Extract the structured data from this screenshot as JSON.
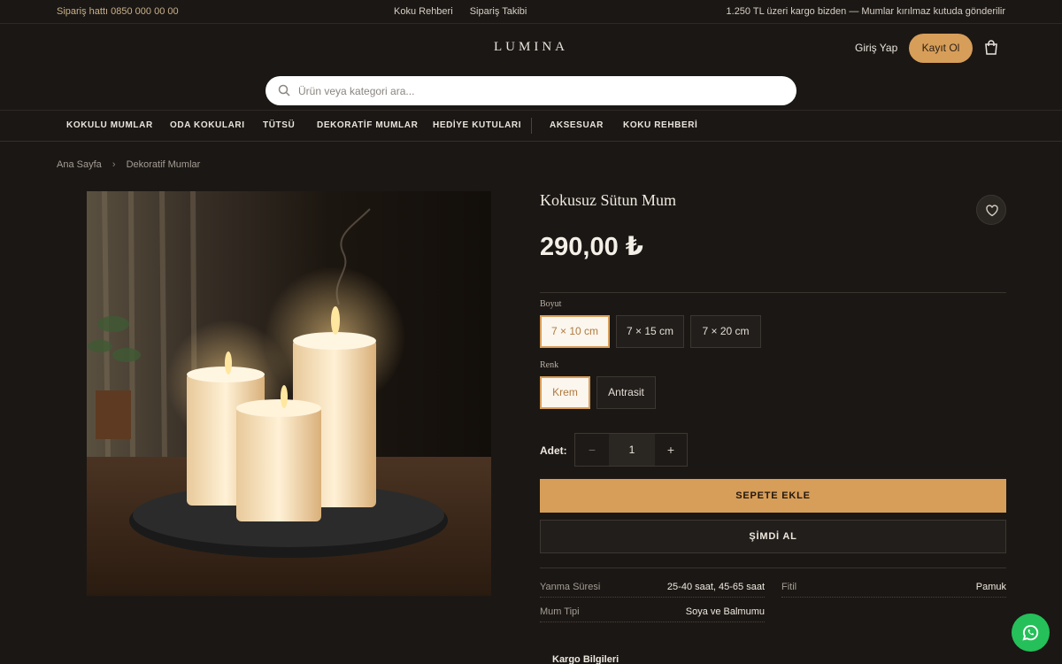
{
  "topbar": {
    "hotline": "Sipariş hattı 0850 000 00 00",
    "links": [
      "Koku Rehberi",
      "Sipariş Takibi"
    ],
    "shipping_note": "1.250 TL üzeri kargo bizden — Mumlar kırılmaz kutuda gönderilir"
  },
  "header": {
    "logo": "LUMINA",
    "login_label": "Giriş Yap",
    "register_label": "Kayıt Ol",
    "cart_icon": "shopping-bag-icon"
  },
  "search": {
    "placeholder": "Ürün veya kategori ara...",
    "value": ""
  },
  "nav": {
    "items": [
      "KOKULU MUMLAR",
      "ODA KOKULARI",
      "TÜTSÜ",
      "DEKORATİF MUMLAR",
      "HEDİYE KUTULARI",
      "AKSESUAR",
      "KOKU REHBERİ"
    ]
  },
  "breadcrumb": {
    "home": "Ana Sayfa",
    "separator": "›",
    "current": "Dekoratif Mumlar"
  },
  "product": {
    "title": "Kokusuz Sütun Mum",
    "price": "290,00 ₺",
    "size_label": "Boyut",
    "sizes": [
      "7 × 10 cm",
      "7 × 15 cm",
      "7 × 20 cm"
    ],
    "selected_size": "7 × 10 cm",
    "color_label": "Renk",
    "colors": [
      "Krem",
      "Antrasit"
    ],
    "selected_color": "Krem",
    "quantity_label": "Adet:",
    "quantity": "1",
    "qty_minus": "−",
    "qty_plus": "+",
    "add_to_cart": "SEPETE EKLE",
    "buy_now": "ŞİMDİ AL",
    "specs": [
      {
        "key": "Yanma Süresi",
        "value": "25-40 saat, 45-65 saat"
      },
      {
        "key": "Fitil",
        "value": "Pamuk"
      },
      {
        "key": "Mum Tipi",
        "value": "Soya ve Balmumu"
      }
    ],
    "shipping_section": "Kargo Bilgileri"
  },
  "colors": {
    "accent": "#d79e59",
    "background": "#1b1714",
    "whatsapp": "#25c05a"
  }
}
